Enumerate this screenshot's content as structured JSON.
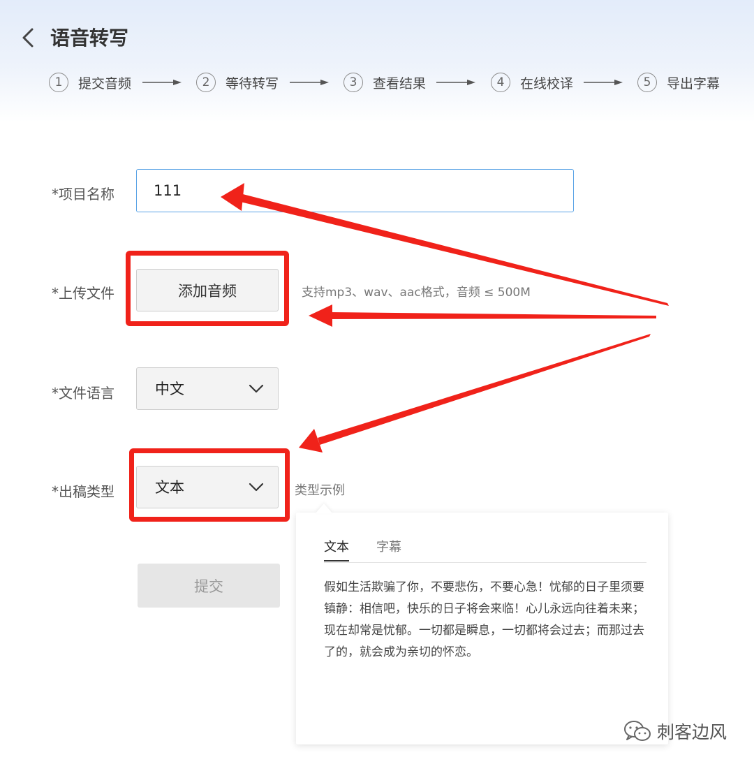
{
  "header": {
    "title": "语音转写",
    "steps": [
      {
        "num": "1",
        "label": "提交音频"
      },
      {
        "num": "2",
        "label": "等待转写"
      },
      {
        "num": "3",
        "label": "查看结果"
      },
      {
        "num": "4",
        "label": "在线校译"
      },
      {
        "num": "5",
        "label": "导出字幕"
      }
    ]
  },
  "form": {
    "project_name": {
      "label": "*项目名称",
      "value": "111"
    },
    "upload": {
      "label": "*上传文件",
      "button": "添加音频",
      "hint": "支持mp3、wav、aac格式，音频 ≤ 500M"
    },
    "language": {
      "label": "*文件语言",
      "selected": "中文"
    },
    "output_type": {
      "label": "*出稿类型",
      "selected": "文本",
      "sample_link": "类型示例"
    },
    "submit": "提交"
  },
  "popover": {
    "tabs": [
      {
        "label": "文本",
        "active": true
      },
      {
        "label": "字幕",
        "active": false
      }
    ],
    "body": "假如生活欺骗了你，不要悲伤，不要心急！忧郁的日子里须要镇静：相信吧，快乐的日子将会来临！心儿永远向往着未来；现在却常是忧郁。一切都是瞬息，一切都将会过去；而那过去了的，就会成为亲切的怀恋。"
  },
  "watermark": {
    "text": "刺客边风",
    "icon": "wechat-icon"
  },
  "colors": {
    "annotation_red": "#f0221a",
    "input_focus_border": "#5aa3e6"
  }
}
